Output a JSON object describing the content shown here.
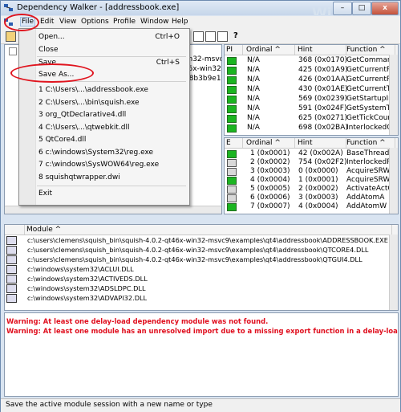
{
  "window": {
    "title": "Dependency Walker - [addressbook.exe]",
    "watermark": "Windows",
    "buttons": {
      "minimize": "–",
      "maximize": "□",
      "close": "x"
    }
  },
  "menubar": {
    "file": "File",
    "edit": "Edit",
    "view": "View",
    "options": "Options",
    "profile": "Profile",
    "window": "Window",
    "help": "Help"
  },
  "file_menu": {
    "open": "Open...",
    "open_shortcut": "Ctrl+O",
    "close": "Close",
    "save": "Save",
    "save_shortcut": "Ctrl+S",
    "save_as": "Save As...",
    "recent": [
      "1 C:\\Users\\...\\addressbook.exe",
      "2 C:\\Users\\...\\bin\\squish.exe",
      "3 org_QtDeclarative4.dll",
      "4 C:\\Users\\...\\qtwebkit.dll",
      "5 QtCore4.dll",
      "6 c:\\windows\\System32\\reg.exe",
      "7 c:\\windows\\SysWOW64\\reg.exe",
      "8 squishqtwrapper.dwi"
    ],
    "exit": "Exit"
  },
  "tree": {
    "fragments": [
      "in32-msvc",
      "i6x-win32",
      "r8b3b9e1"
    ]
  },
  "imports": {
    "headers": {
      "pi": "PI",
      "ordinal": "Ordinal ^",
      "hint": "Hint",
      "function": "Function ^"
    },
    "rows": [
      {
        "ordinal": "N/A",
        "hint": "368 (0x0170)",
        "function": "GetCommand"
      },
      {
        "ordinal": "N/A",
        "hint": "425 (0x01A9)",
        "function": "GetCurrentPr"
      },
      {
        "ordinal": "N/A",
        "hint": "426 (0x01AA)",
        "function": "GetCurrentPro"
      },
      {
        "ordinal": "N/A",
        "hint": "430 (0x01AE)",
        "function": "GetCurrentTh"
      },
      {
        "ordinal": "N/A",
        "hint": "569 (0x0239)",
        "function": "GetStartupInf"
      },
      {
        "ordinal": "N/A",
        "hint": "591 (0x024F)",
        "function": "GetSystemTim"
      },
      {
        "ordinal": "N/A",
        "hint": "625 (0x0271)",
        "function": "GetTickCount"
      },
      {
        "ordinal": "N/A",
        "hint": "698 (0x02BA)",
        "function": "InterlockedCo"
      }
    ]
  },
  "exports": {
    "headers": {
      "e": "E",
      "ordinal": "Ordinal ^",
      "hint": "Hint",
      "function": "Function ^"
    },
    "rows": [
      {
        "ordinal": "1 (0x0001)",
        "hint": "42 (0x002A)",
        "function": "BaseThreadIni"
      },
      {
        "ordinal": "2 (0x0002)",
        "hint": "754 (0x02F2)",
        "function": "InterlockedPu"
      },
      {
        "ordinal": "3 (0x0003)",
        "hint": "0 (0x0000)",
        "function": "AcquireSRWLo"
      },
      {
        "ordinal": "4 (0x0004)",
        "hint": "1 (0x0001)",
        "function": "AcquireSRWLo"
      },
      {
        "ordinal": "5 (0x0005)",
        "hint": "2 (0x0002)",
        "function": "ActivateActCt"
      },
      {
        "ordinal": "6 (0x0006)",
        "hint": "3 (0x0003)",
        "function": "AddAtomA"
      },
      {
        "ordinal": "7 (0x0007)",
        "hint": "4 (0x0004)",
        "function": "AddAtomW"
      }
    ]
  },
  "modules": {
    "header": "Module ^",
    "rows": [
      "c:\\users\\clemens\\squish_bin\\squish-4.0.2-qt46x-win32-msvc9\\examples\\qt4\\addressbook\\ADDRESSBOOK.EXE",
      "c:\\users\\clemens\\squish_bin\\squish-4.0.2-qt46x-win32-msvc9\\examples\\qt4\\addressbook\\QTCORE4.DLL",
      "c:\\users\\clemens\\squish_bin\\squish-4.0.2-qt46x-win32-msvc9\\examples\\qt4\\addressbook\\QTGUI4.DLL",
      "c:\\windows\\system32\\ACLUI.DLL",
      "c:\\windows\\system32\\ACTIVEDS.DLL",
      "c:\\windows\\system32\\ADSLDPC.DLL",
      "c:\\windows\\system32\\ADVAPI32.DLL"
    ]
  },
  "log": {
    "warning1": "Warning: At least one delay-load dependency module was not found.",
    "warning2": "Warning: At least one module has an unresolved import due to a missing export function in a delay-load dependent module."
  },
  "statusbar": {
    "text": "Save the active module session with a new name or type"
  },
  "colors": {
    "warning": "#e0101f",
    "highlight_circle": "#e0141e",
    "ok_icon": "#1bb521"
  }
}
